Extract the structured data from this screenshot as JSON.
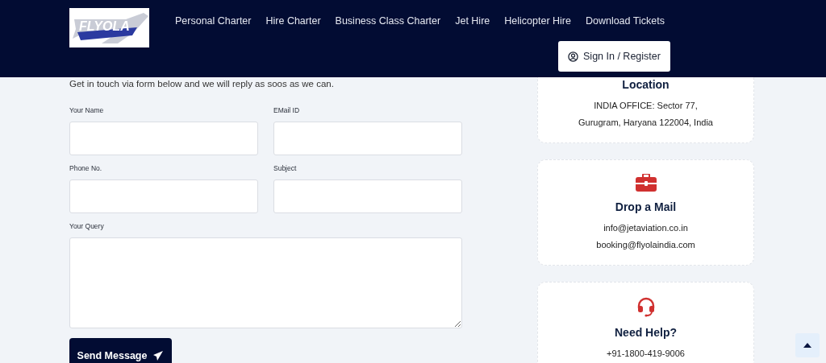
{
  "header": {
    "logo": {
      "text": "FLYOLA"
    },
    "nav": [
      {
        "label": "Personal Charter"
      },
      {
        "label": "Hire Charter"
      },
      {
        "label": "Business Class Charter"
      },
      {
        "label": "Jet Hire"
      },
      {
        "label": "Helicopter Hire"
      },
      {
        "label": "Download Tickets"
      }
    ],
    "sign_in": {
      "label": "Sign In / Register"
    }
  },
  "form": {
    "intro": "Get in touch via form below and we will reply as soos as we can.",
    "fields": [
      {
        "kind": "input",
        "label": "Your Name"
      },
      {
        "kind": "input",
        "label": "EMail ID"
      },
      {
        "kind": "input",
        "label": "Phone No."
      },
      {
        "kind": "input",
        "label": "Subject"
      },
      {
        "kind": "textarea",
        "label": "Your Query"
      }
    ],
    "submit": {
      "label": "Send Message"
    }
  },
  "contact_cards": [
    {
      "kind": "location",
      "title": "Location",
      "lines": [
        "INDIA OFFICE: Sector 77,",
        "Gurugram, Haryana 122004, India"
      ]
    },
    {
      "kind": "mail",
      "title": "Drop a Mail",
      "lines": [
        "info@jetaviation.co.in",
        "booking@flyolaindia.com"
      ]
    },
    {
      "kind": "help",
      "title": "Need Help?",
      "lines": [
        "+91-1800-419-9006"
      ]
    }
  ]
}
